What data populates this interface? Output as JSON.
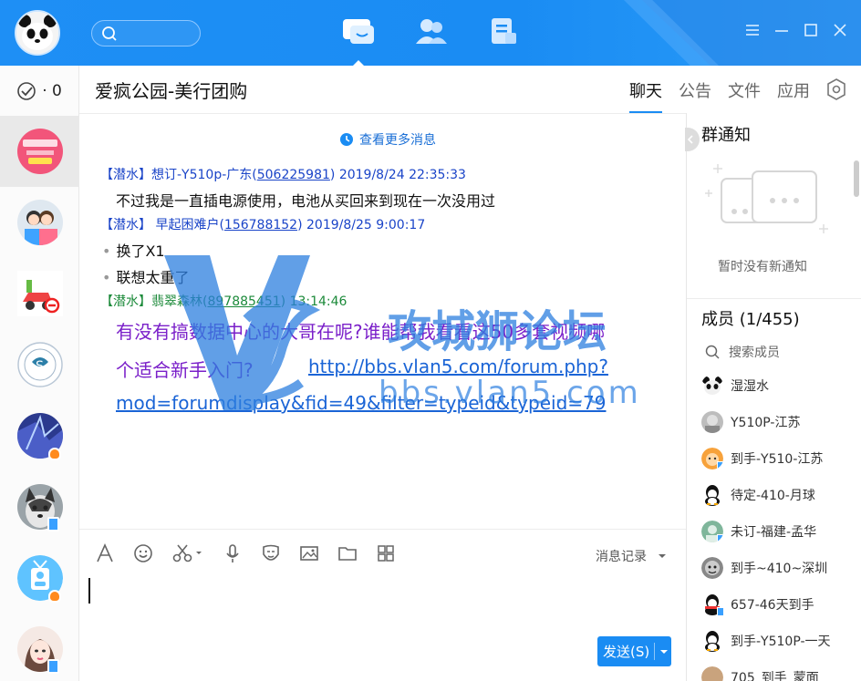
{
  "sidebar": {
    "counter": "· 0"
  },
  "chat": {
    "title": "爱疯公园-美行团购",
    "tabs": [
      {
        "label": "聊天",
        "active": true
      },
      {
        "label": "公告"
      },
      {
        "label": "文件"
      },
      {
        "label": "应用"
      }
    ],
    "more_messages": "查看更多消息",
    "messages": [
      {
        "tag": "【潜水】",
        "name": "想订-Y510p-广东",
        "uid": "506225981",
        "time": "2019/8/24 22:35:33",
        "lines": [
          "不过我是一直插电源使用，电池从买回来到现在一次没用过"
        ]
      },
      {
        "tag": "【潜水】",
        "name": "早起困难户",
        "uid": "156788152",
        "time": "2019/8/25 9:00:17",
        "lines": [
          "换了X1",
          "联想太重了"
        ]
      },
      {
        "tag": "【潜水】",
        "name": "翡翠森林",
        "uid": "897885451",
        "time": "13:14:46",
        "lines": [
          "有没有搞数据中心的大哥在呢?谁能帮我看看这50多套视频哪",
          "个适合新手入门?"
        ],
        "link": [
          "http://bbs.vlan5.com/forum.php?",
          "mod=forumdisplay&fid=49&filter=typeid&typeid=79"
        ]
      }
    ],
    "watermark": {
      "line1": "攻城狮论坛",
      "line2": "bbs.vlan5.com"
    }
  },
  "input": {
    "history_label": "消息记录",
    "send_label": "发送(S)"
  },
  "group": {
    "notice_title": "群通知",
    "notice_empty": "暂时没有新通知",
    "members_title": "成员 (1/455)",
    "search_label": "搜索成员",
    "members": [
      {
        "name": "湿湿水"
      },
      {
        "name": "Y510P-江苏"
      },
      {
        "name": "到手-Y510-江苏"
      },
      {
        "name": "待定-410-月球"
      },
      {
        "name": "未订-福建-孟华"
      },
      {
        "name": "到手~410~深圳"
      },
      {
        "name": "657-46天到手"
      },
      {
        "name": "到手-Y510P-一天"
      },
      {
        "name": "705_到手_蒙面"
      }
    ]
  },
  "colors": {
    "brand": "#1a8cf3",
    "name_blue": "#1a44c8",
    "name_green": "#1c8a3a",
    "purple_text": "#7a1fc9"
  }
}
